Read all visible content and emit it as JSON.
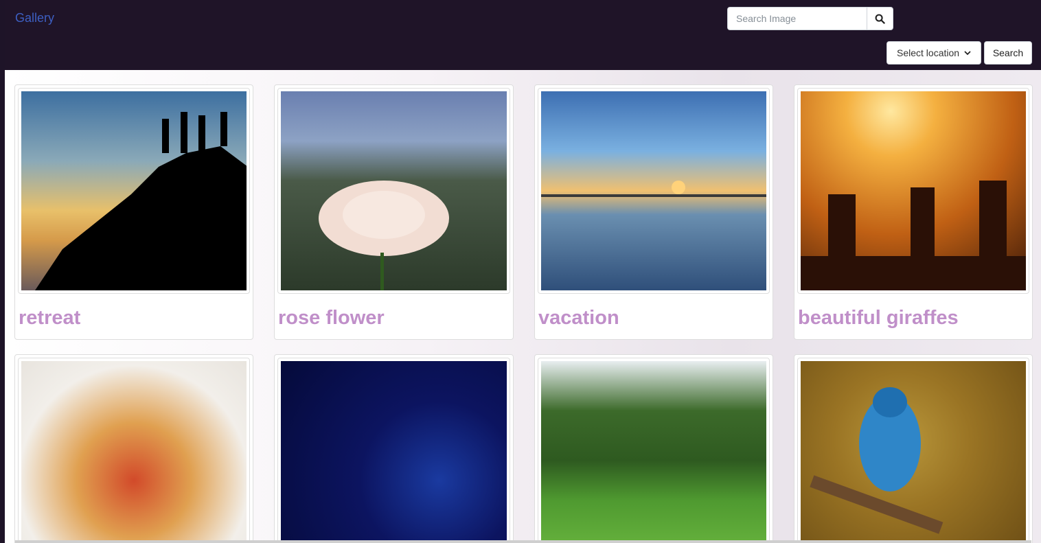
{
  "navbar": {
    "brand": "Gallery",
    "search_placeholder": "Search Image",
    "location_select_value": "Select location",
    "search_button": "Search"
  },
  "gallery": {
    "items": [
      {
        "caption": "retreat"
      },
      {
        "caption": "rose flower"
      },
      {
        "caption": "vacation"
      },
      {
        "caption": "beautiful giraffes"
      },
      {
        "caption": ""
      },
      {
        "caption": ""
      },
      {
        "caption": ""
      },
      {
        "caption": ""
      }
    ]
  },
  "colors": {
    "navbar_bg": "#1f1428",
    "brand": "#3d5fc2",
    "caption": "#c08fc9"
  }
}
